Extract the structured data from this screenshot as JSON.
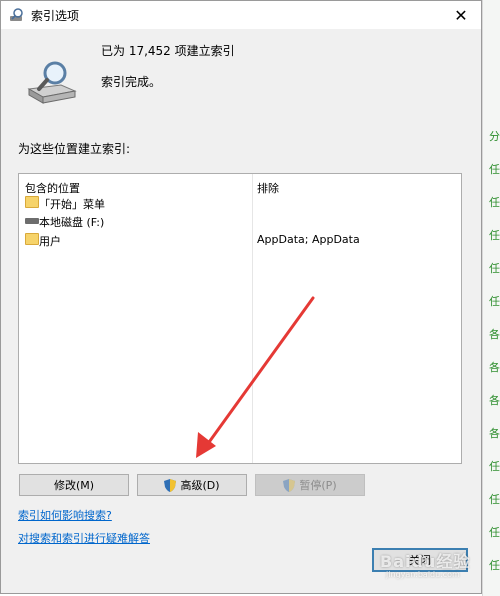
{
  "window": {
    "title": "索引选项",
    "close_glyph": "✕"
  },
  "status": {
    "count_text": "已为 17,452 项建立索引",
    "done_text": "索引完成。",
    "icon": "magnifier-drive-icon"
  },
  "locations": {
    "section_label": "为这些位置建立索引:",
    "col_included": "包含的位置",
    "col_excluded": "排除",
    "rows": [
      {
        "location": "「开始」菜单",
        "exclude": "",
        "icon": "folder-icon"
      },
      {
        "location": "本地磁盘 (F:)",
        "exclude": "",
        "icon": "drive-icon"
      },
      {
        "location": "用户",
        "exclude": "AppData; AppData",
        "icon": "folder-icon"
      }
    ]
  },
  "buttons": {
    "modify": "修改(M)",
    "advanced": "高级(D)",
    "pause": "暂停(P)",
    "close": "关闭"
  },
  "links": {
    "how": "索引如何影响搜索?",
    "trouble": "对搜索和索引进行疑难解答"
  },
  "background_glyphs": [
    "分",
    "任",
    "任",
    "任",
    "任",
    "任",
    "各",
    "各",
    "各",
    "各",
    "任",
    "任",
    "任",
    "任"
  ],
  "watermark": {
    "text": "Baidu经验",
    "sub": "jingyan.baidu.com"
  },
  "colors": {
    "link": "#0066cc",
    "arrow": "#e53935",
    "folder": "#f6d36a"
  }
}
